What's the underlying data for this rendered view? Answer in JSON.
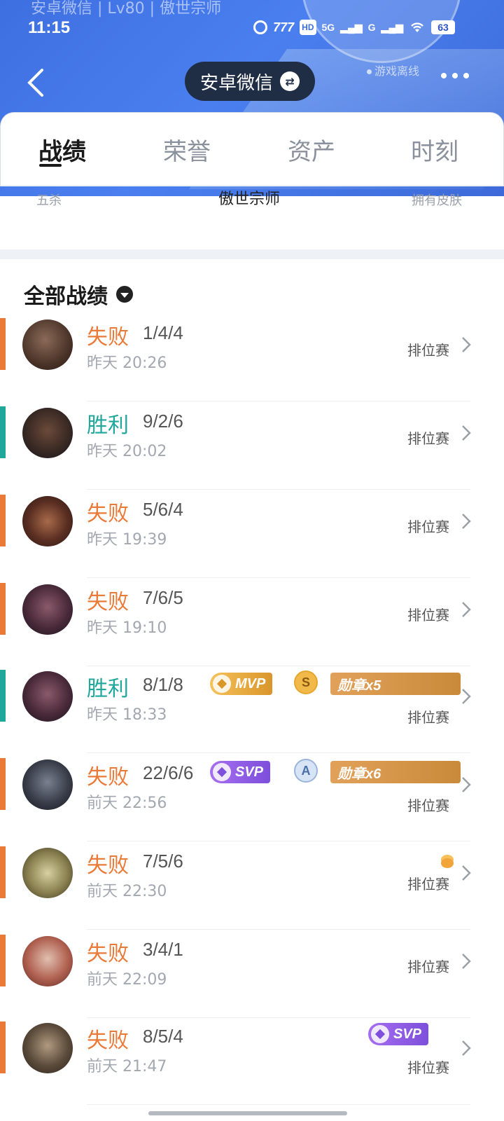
{
  "status_bar": {
    "caption": "安卓微信 | Lv80 | 傲世宗师",
    "time": "11:15",
    "battery": "63",
    "network_labels": [
      "5G",
      "G"
    ],
    "hd_label": "HD"
  },
  "header": {
    "title": "安卓微信",
    "offline_label": "游戏离线"
  },
  "tabs": [
    {
      "label": "战绩",
      "active": true
    },
    {
      "label": "荣誉",
      "active": false
    },
    {
      "label": "资产",
      "active": false
    },
    {
      "label": "时刻",
      "active": false
    }
  ],
  "stats": {
    "left_label": "五杀",
    "center_label": "傲世宗师",
    "right_label": "拥有皮肤"
  },
  "records_title": "全部战绩",
  "colors": {
    "loss": "#ea7a38",
    "win": "#1fa79b",
    "header_blue": "#4a7ff0"
  },
  "records": [
    {
      "result": "失败",
      "kda": "1/4/4",
      "time": "昨天 20:26",
      "mode": "排位赛",
      "outcome": "loss",
      "badges": []
    },
    {
      "result": "胜利",
      "kda": "9/2/6",
      "time": "昨天 20:02",
      "mode": "排位赛",
      "outcome": "win",
      "badges": []
    },
    {
      "result": "失败",
      "kda": "5/6/4",
      "time": "昨天 19:39",
      "mode": "排位赛",
      "outcome": "loss",
      "badges": []
    },
    {
      "result": "失败",
      "kda": "7/6/5",
      "time": "昨天 19:10",
      "mode": "排位赛",
      "outcome": "loss",
      "badges": []
    },
    {
      "result": "胜利",
      "kda": "8/1/8",
      "time": "昨天 18:33",
      "mode": "排位赛",
      "outcome": "win",
      "badges": [
        "MVP",
        "S",
        "勋章x5"
      ]
    },
    {
      "result": "失败",
      "kda": "22/6/6",
      "time": "前天 22:56",
      "mode": "排位赛",
      "outcome": "loss",
      "badges": [
        "SVP",
        "A",
        "勋章x6"
      ]
    },
    {
      "result": "失败",
      "kda": "7/5/6",
      "time": "前天 22:30",
      "mode": "排位赛",
      "outcome": "loss",
      "badges": [
        "coin"
      ]
    },
    {
      "result": "失败",
      "kda": "3/4/1",
      "time": "前天 22:09",
      "mode": "排位赛",
      "outcome": "loss",
      "badges": []
    },
    {
      "result": "失败",
      "kda": "8/5/4",
      "time": "前天 21:47",
      "mode": "排位赛",
      "outcome": "loss",
      "badges": [
        "SVP"
      ]
    }
  ],
  "badge_text": {
    "mvp": "MVP",
    "svp": "SVP",
    "grade_s": "S",
    "grade_a": "A",
    "medal5": "勋章x5",
    "medal6": "勋章x6"
  }
}
